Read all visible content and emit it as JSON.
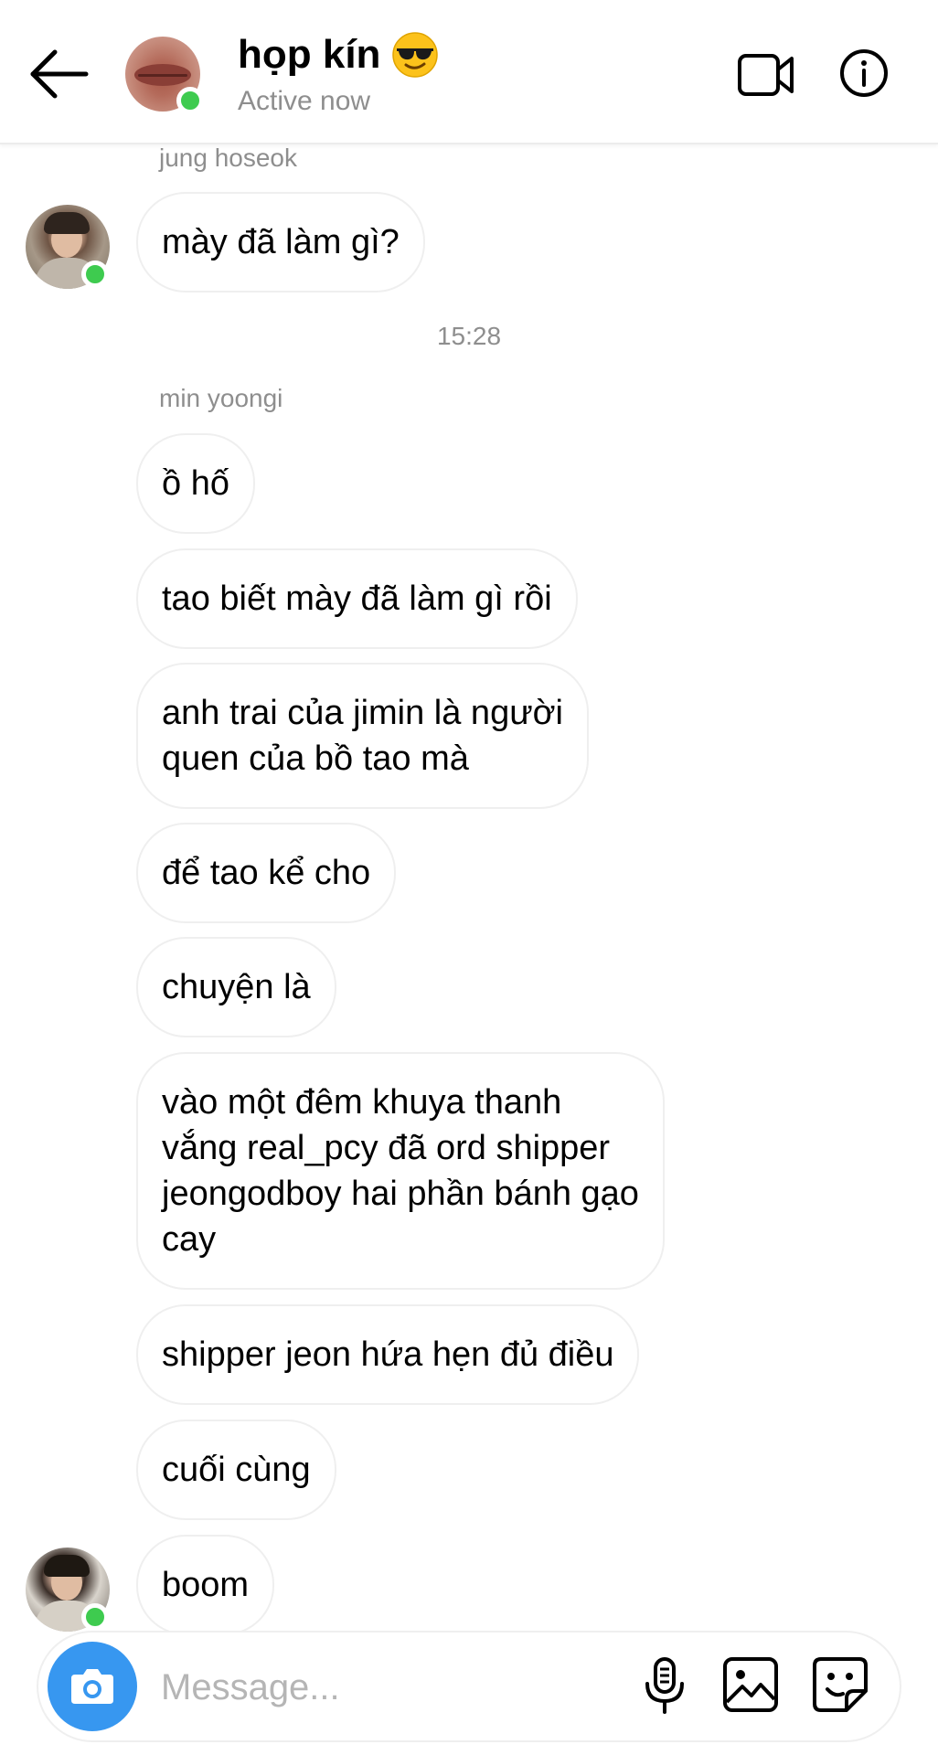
{
  "header": {
    "title": "họp kín",
    "title_emoji": "sunglasses-emoji",
    "status": "Active now",
    "back_icon": "arrow-left-icon",
    "video_icon": "video-camera-icon",
    "info_icon": "info-icon"
  },
  "messages": {
    "sender_1": "jung hoseok",
    "msg_1": "mày đã làm gì?",
    "timestamp": "15:28",
    "sender_2": "min yoongi",
    "msg_2": "ồ hố",
    "msg_3": "tao biết mày đã làm gì rồi",
    "msg_4_line1": "anh trai của jimin là người",
    "msg_4_line2": "quen của bồ tao mà",
    "msg_5": "để tao kể cho",
    "msg_6": "chuyện là",
    "msg_7_line1": "vào một đêm khuya thanh",
    "msg_7_line2": "vắng real_pcy đã ord shipper",
    "msg_7_line3": "jeongodboy hai phần bánh gạo",
    "msg_7_line4": "cay",
    "msg_8": "shipper jeon hứa hẹn đủ điều",
    "msg_9": "cuối cùng",
    "msg_10": "boom"
  },
  "composer": {
    "placeholder": "Message...",
    "value": "",
    "camera_icon": "camera-icon",
    "mic_icon": "microphone-icon",
    "gallery_icon": "image-gallery-icon",
    "sticker_icon": "sticker-icon"
  },
  "colors": {
    "accent": "#3797f0",
    "online": "#3ecb4f",
    "secondary_text": "#8e8e8e",
    "bubble_border": "#efefef"
  }
}
